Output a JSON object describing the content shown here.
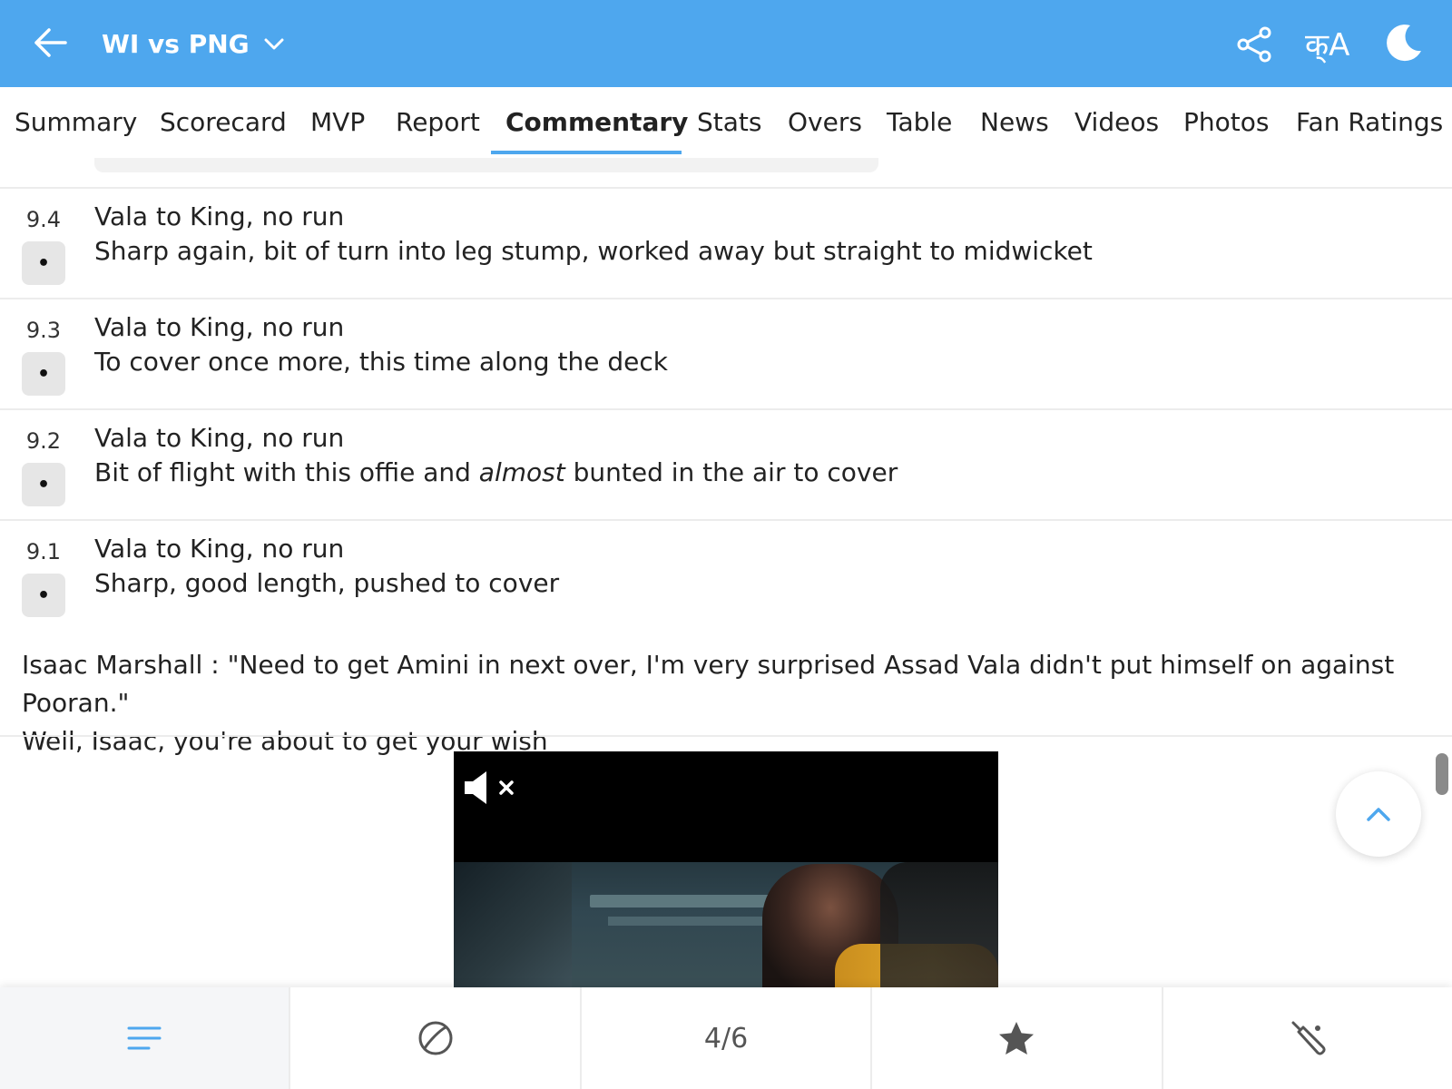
{
  "header": {
    "match_title": "WI vs PNG",
    "lang_label": "क्A"
  },
  "tabs": [
    {
      "label": "Summary"
    },
    {
      "label": "Scorecard"
    },
    {
      "label": "MVP"
    },
    {
      "label": "Report"
    },
    {
      "label": "Commentary",
      "active": true
    },
    {
      "label": "Stats"
    },
    {
      "label": "Overs"
    },
    {
      "label": "Table"
    },
    {
      "label": "News"
    },
    {
      "label": "Videos"
    },
    {
      "label": "Photos"
    },
    {
      "label": "Fan Ratings"
    }
  ],
  "commentary": [
    {
      "over": "9.4",
      "ball_result": "•",
      "title": "Vala to King, no run",
      "text": "Sharp again, bit of turn into leg stump, worked away but straight to midwicket"
    },
    {
      "over": "9.3",
      "ball_result": "•",
      "title": "Vala to King, no run",
      "text": "To cover once more, this time along the deck"
    },
    {
      "over": "9.2",
      "ball_result": "•",
      "title": "Vala to King, no run",
      "text_before": "Bit of flight with this offie and ",
      "text_emph": "almost",
      "text_after": " bunted in the air to cover"
    },
    {
      "over": "9.1",
      "ball_result": "•",
      "title": "Vala to King, no run",
      "text": "Sharp, good length, pushed to cover"
    }
  ],
  "note": {
    "line1": "Isaac Marshall : \"Need to get Amini in next over, I'm very surprised Assad Vala didn't put himself on against Pooran.\"",
    "line2": "Well, Isaac, you're about to get your wish"
  },
  "bottom_bar": {
    "items": [
      {
        "icon": "menu-lines-icon"
      },
      {
        "icon": "cricket-ball-icon"
      },
      {
        "label": "4/6"
      },
      {
        "icon": "star-icon"
      },
      {
        "icon": "cricket-bat-icon"
      }
    ]
  },
  "colors": {
    "accent": "#4ea7ee",
    "header_bg": "#4ea7ee",
    "badge_bg": "#e6e6e6"
  }
}
